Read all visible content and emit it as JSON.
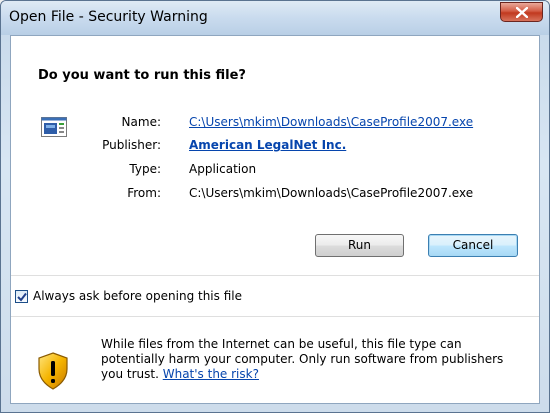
{
  "window": {
    "title": "Open File - Security Warning"
  },
  "dialog": {
    "question": "Do you want to run this file?",
    "fields": {
      "name_label": "Name:",
      "name_value": "C:\\Users\\mkim\\Downloads\\CaseProfile2007.exe",
      "publisher_label": "Publisher:",
      "publisher_value": "American LegalNet Inc.",
      "type_label": "Type:",
      "type_value": "Application",
      "from_label": "From:",
      "from_value": "C:\\Users\\mkim\\Downloads\\CaseProfile2007.exe"
    },
    "buttons": {
      "run": "Run",
      "cancel": "Cancel"
    },
    "checkbox": {
      "label": "Always ask before opening this file",
      "checked": true
    },
    "warning": {
      "text": "While files from the Internet can be useful, this file type can potentially harm your computer. Only run software from publishers you trust.",
      "link": "What's the risk?"
    }
  },
  "icons": {
    "close": "close-icon",
    "file": "application-file-icon",
    "shield": "shield-warning-icon",
    "check": "checkmark-icon"
  },
  "colors": {
    "link": "#0645ad",
    "title_bar": "#c9dbee",
    "close_button": "#c1391f"
  }
}
